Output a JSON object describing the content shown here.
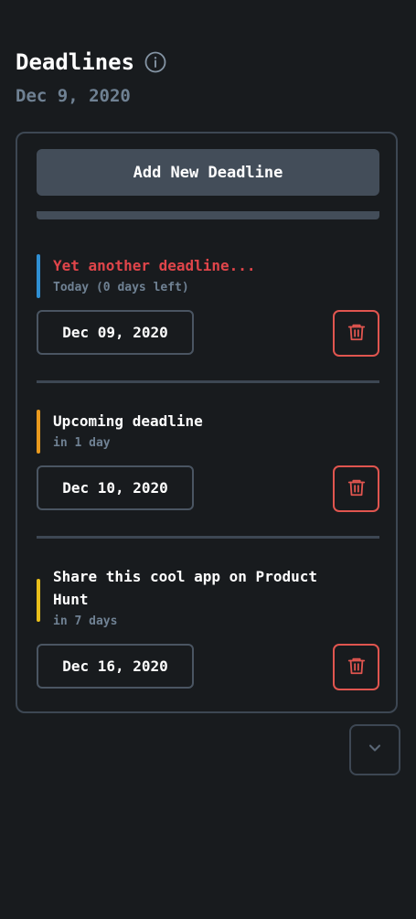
{
  "header": {
    "title": "Deadlines",
    "date": "Dec 9, 2020"
  },
  "add_button_label": "Add New Deadline",
  "deadlines": [
    {
      "title": "Yet another deadline...",
      "title_color": "#e0454a",
      "accent_color": "#2f8fd3",
      "subtitle": "Today (0 days left)",
      "date": "Dec 09, 2020"
    },
    {
      "title": "Upcoming deadline",
      "title_color": "#ffffff",
      "accent_color": "#e99a1e",
      "subtitle": "in 1 day",
      "date": "Dec 10, 2020"
    },
    {
      "title": "Share this cool app on Product Hunt",
      "title_color": "#ffffff",
      "accent_color": "#e9bf1b",
      "subtitle": "in 7 days",
      "date": "Dec 16, 2020"
    }
  ],
  "icons": {
    "info": "info-icon",
    "delete": "trash-icon",
    "collapse": "chevron-down-icon"
  },
  "colors": {
    "background": "#181b1e",
    "muted_text": "#6f8193",
    "danger": "#e0554f",
    "border": "#3d4753"
  }
}
